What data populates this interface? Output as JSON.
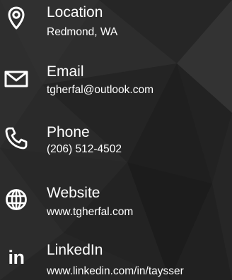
{
  "contacts": [
    {
      "title": "Location",
      "value": "Redmond, WA",
      "icon": "map-pin-icon"
    },
    {
      "title": "Email",
      "value": "tgherfal@outlook.com",
      "icon": "envelope-icon"
    },
    {
      "title": "Phone",
      "value": "(206) 512-4502",
      "icon": "phone-icon"
    },
    {
      "title": "Website",
      "value": "www.tgherfal.com",
      "icon": "globe-icon"
    },
    {
      "title": "LinkedIn",
      "value": "www.linkedin.com/in/taysser",
      "icon": "linkedin-icon",
      "icon_text": "in"
    }
  ]
}
